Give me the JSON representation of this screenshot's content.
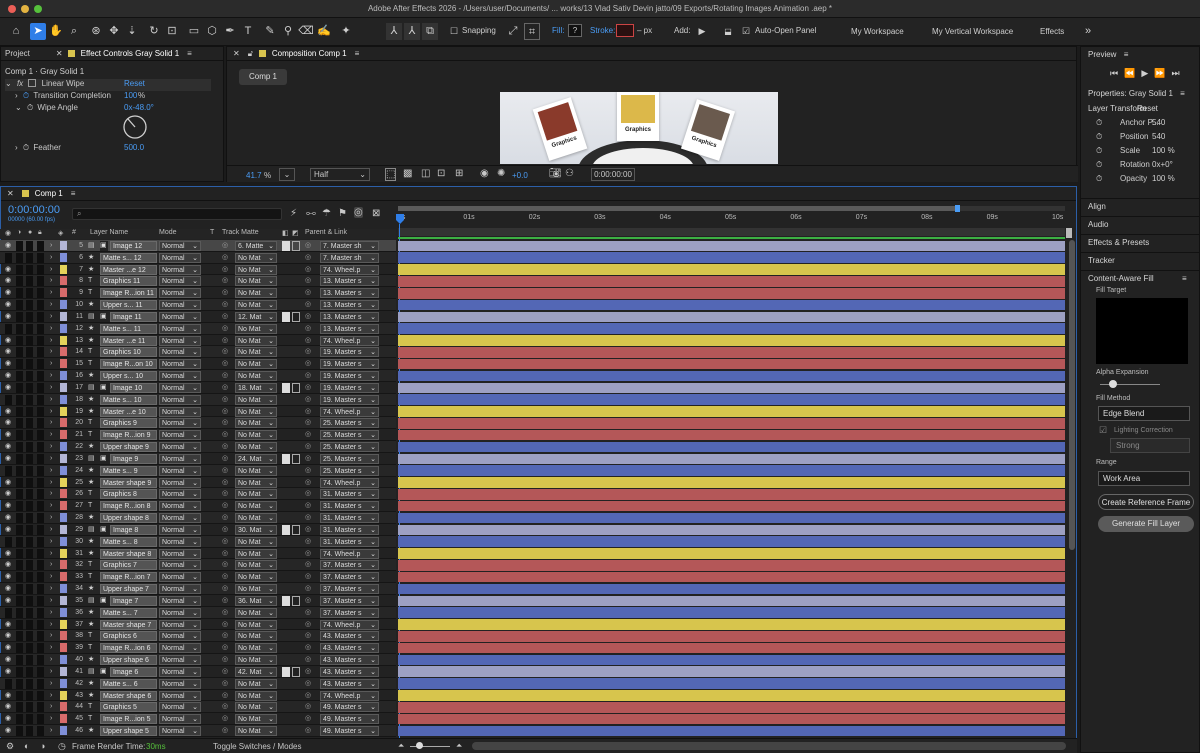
{
  "window": {
    "title": "Adobe After Effects 2026 - /Users/user/Documents/ ... works/13 Vlad Sativ Devin jatto/09 Exports/Rotating Images Animation .aep *"
  },
  "toolbar": {
    "snapping": "Snapping",
    "fill_label": "Fill:",
    "fill_value": "?",
    "stroke_label": "Stroke:",
    "stroke_px": "– px",
    "add_label": "Add:",
    "auto_open": "Auto-Open Panel",
    "workspaces": [
      "My Workspace",
      "My Vertical Workspace",
      "Effects"
    ]
  },
  "left_panel": {
    "tab_project": "Project",
    "tab_effect": "Effect Controls Gray Solid 1",
    "subtitle": "Comp 1 · Gray Solid 1",
    "fx_label": "fx",
    "effect_name": "Linear Wipe",
    "reset": "Reset",
    "props": [
      {
        "name": "Transition Completion",
        "value": "100",
        "unit": "%"
      },
      {
        "name": "Wipe Angle",
        "value": "0x-48.0°",
        "unit": ""
      },
      {
        "name": "Feather",
        "value": "500.0",
        "unit": ""
      }
    ]
  },
  "comp_panel": {
    "tab": "Composition Comp 1",
    "comp_button": "Comp 1",
    "cards": [
      "Graphics",
      "Graphics",
      "Graphics"
    ],
    "zoom": "41.7",
    "zoom_unit": "%",
    "resolution": "Half",
    "exposure": "+0.0",
    "timecode": "0:00:00:00"
  },
  "timeline": {
    "tab": "Comp 1",
    "timecode": "0:00:00:00",
    "fps": "00000 (60.00 fps)",
    "search_icon": "search-icon",
    "columns": {
      "layer_name": "Layer Name",
      "mode": "Mode",
      "t": "T",
      "track_matte": "Track Matte",
      "parent": "Parent & Link",
      "hash": "#"
    },
    "ticks": [
      "0s",
      "01s",
      "02s",
      "03s",
      "04s",
      "05s",
      "06s",
      "07s",
      "08s",
      "09s",
      "10s"
    ],
    "layers": [
      {
        "num": "5",
        "type": "img",
        "name": "Image 12",
        "mode": "Normal",
        "matte": "6. Matte",
        "par": "7. Master sh",
        "color": "lilac",
        "eye": true,
        "sel": true
      },
      {
        "num": "6",
        "type": "star",
        "name": "Matte s... 12",
        "mode": "Normal",
        "matte": "No Mat",
        "par": "7. Master sh",
        "color": "blue",
        "eye": false,
        "sel": false
      },
      {
        "num": "7",
        "type": "star",
        "name": "Master ...e 12",
        "mode": "Normal",
        "matte": "No Mat",
        "par": "74. Wheel.p",
        "color": "yellow",
        "eye": true,
        "sel": false
      },
      {
        "num": "8",
        "type": "T",
        "name": "Graphics 11",
        "mode": "Normal",
        "matte": "No Mat",
        "par": "13. Master s",
        "color": "red",
        "eye": true,
        "sel": false
      },
      {
        "num": "9",
        "type": "T",
        "name": "Image R...ion 11",
        "mode": "Normal",
        "matte": "No Mat",
        "par": "13. Master s",
        "color": "red",
        "eye": true,
        "sel": false
      },
      {
        "num": "10",
        "type": "star",
        "name": "Upper s... 11",
        "mode": "Normal",
        "matte": "No Mat",
        "par": "13. Master s",
        "color": "blue",
        "eye": true,
        "sel": false
      },
      {
        "num": "11",
        "type": "img",
        "name": "Image 11",
        "mode": "Normal",
        "matte": "12. Mat",
        "par": "13. Master s",
        "color": "lilac",
        "eye": true,
        "sel": false
      },
      {
        "num": "12",
        "type": "star",
        "name": "Matte s... 11",
        "mode": "Normal",
        "matte": "No Mat",
        "par": "13. Master s",
        "color": "blue",
        "eye": false,
        "sel": false
      },
      {
        "num": "13",
        "type": "star",
        "name": "Master ...e 11",
        "mode": "Normal",
        "matte": "No Mat",
        "par": "74. Wheel.p",
        "color": "yellow",
        "eye": true,
        "sel": false
      },
      {
        "num": "14",
        "type": "T",
        "name": "Graphics 10",
        "mode": "Normal",
        "matte": "No Mat",
        "par": "19. Master s",
        "color": "red",
        "eye": true,
        "sel": false
      },
      {
        "num": "15",
        "type": "T",
        "name": "Image R...on 10",
        "mode": "Normal",
        "matte": "No Mat",
        "par": "19. Master s",
        "color": "red",
        "eye": true,
        "sel": false
      },
      {
        "num": "16",
        "type": "star",
        "name": "Upper s... 10",
        "mode": "Normal",
        "matte": "No Mat",
        "par": "19. Master s",
        "color": "blue",
        "eye": true,
        "sel": false
      },
      {
        "num": "17",
        "type": "img",
        "name": "Image 10",
        "mode": "Normal",
        "matte": "18. Mat",
        "par": "19. Master s",
        "color": "lilac",
        "eye": true,
        "sel": false
      },
      {
        "num": "18",
        "type": "star",
        "name": "Matte s... 10",
        "mode": "Normal",
        "matte": "No Mat",
        "par": "19. Master s",
        "color": "blue",
        "eye": false,
        "sel": false
      },
      {
        "num": "19",
        "type": "star",
        "name": "Master ...e 10",
        "mode": "Normal",
        "matte": "No Mat",
        "par": "74. Wheel.p",
        "color": "yellow",
        "eye": true,
        "sel": false
      },
      {
        "num": "20",
        "type": "T",
        "name": "Graphics 9",
        "mode": "Normal",
        "matte": "No Mat",
        "par": "25. Master s",
        "color": "red",
        "eye": true,
        "sel": false
      },
      {
        "num": "21",
        "type": "T",
        "name": "Image R...ion 9",
        "mode": "Normal",
        "matte": "No Mat",
        "par": "25. Master s",
        "color": "red",
        "eye": true,
        "sel": false
      },
      {
        "num": "22",
        "type": "star",
        "name": "Upper shape 9",
        "mode": "Normal",
        "matte": "No Mat",
        "par": "25. Master s",
        "color": "blue",
        "eye": true,
        "sel": false
      },
      {
        "num": "23",
        "type": "img",
        "name": "Image 9",
        "mode": "Normal",
        "matte": "24. Mat",
        "par": "25. Master s",
        "color": "lilac",
        "eye": true,
        "sel": false
      },
      {
        "num": "24",
        "type": "star",
        "name": "Matte s... 9",
        "mode": "Normal",
        "matte": "No Mat",
        "par": "25. Master s",
        "color": "blue",
        "eye": false,
        "sel": false
      },
      {
        "num": "25",
        "type": "star",
        "name": "Master shape 9",
        "mode": "Normal",
        "matte": "No Mat",
        "par": "74. Wheel.p",
        "color": "yellow",
        "eye": true,
        "sel": false
      },
      {
        "num": "26",
        "type": "T",
        "name": "Graphics 8",
        "mode": "Normal",
        "matte": "No Mat",
        "par": "31. Master s",
        "color": "red",
        "eye": true,
        "sel": false
      },
      {
        "num": "27",
        "type": "T",
        "name": "Image R...ion 8",
        "mode": "Normal",
        "matte": "No Mat",
        "par": "31. Master s",
        "color": "red",
        "eye": true,
        "sel": false
      },
      {
        "num": "28",
        "type": "star",
        "name": "Upper shape 8",
        "mode": "Normal",
        "matte": "No Mat",
        "par": "31. Master s",
        "color": "blue",
        "eye": true,
        "sel": false
      },
      {
        "num": "29",
        "type": "img",
        "name": "Image 8",
        "mode": "Normal",
        "matte": "30. Mat",
        "par": "31. Master s",
        "color": "lilac",
        "eye": true,
        "sel": false
      },
      {
        "num": "30",
        "type": "star",
        "name": "Matte s... 8",
        "mode": "Normal",
        "matte": "No Mat",
        "par": "31. Master s",
        "color": "blue",
        "eye": false,
        "sel": false
      },
      {
        "num": "31",
        "type": "star",
        "name": "Master shape 8",
        "mode": "Normal",
        "matte": "No Mat",
        "par": "74. Wheel.p",
        "color": "yellow",
        "eye": true,
        "sel": false
      },
      {
        "num": "32",
        "type": "T",
        "name": "Graphics 7",
        "mode": "Normal",
        "matte": "No Mat",
        "par": "37. Master s",
        "color": "red",
        "eye": true,
        "sel": false
      },
      {
        "num": "33",
        "type": "T",
        "name": "Image R...ion 7",
        "mode": "Normal",
        "matte": "No Mat",
        "par": "37. Master s",
        "color": "red",
        "eye": true,
        "sel": false
      },
      {
        "num": "34",
        "type": "star",
        "name": "Upper shape 7",
        "mode": "Normal",
        "matte": "No Mat",
        "par": "37. Master s",
        "color": "blue",
        "eye": true,
        "sel": false
      },
      {
        "num": "35",
        "type": "img",
        "name": "Image 7",
        "mode": "Normal",
        "matte": "36. Mat",
        "par": "37. Master s",
        "color": "lilac",
        "eye": true,
        "sel": false
      },
      {
        "num": "36",
        "type": "star",
        "name": "Matte s... 7",
        "mode": "Normal",
        "matte": "No Mat",
        "par": "37. Master s",
        "color": "blue",
        "eye": false,
        "sel": false
      },
      {
        "num": "37",
        "type": "star",
        "name": "Master shape 7",
        "mode": "Normal",
        "matte": "No Mat",
        "par": "74. Wheel.p",
        "color": "yellow",
        "eye": true,
        "sel": false
      },
      {
        "num": "38",
        "type": "T",
        "name": "Graphics 6",
        "mode": "Normal",
        "matte": "No Mat",
        "par": "43. Master s",
        "color": "red",
        "eye": true,
        "sel": false
      },
      {
        "num": "39",
        "type": "T",
        "name": "Image R...ion 6",
        "mode": "Normal",
        "matte": "No Mat",
        "par": "43. Master s",
        "color": "red",
        "eye": true,
        "sel": false
      },
      {
        "num": "40",
        "type": "star",
        "name": "Upper shape 6",
        "mode": "Normal",
        "matte": "No Mat",
        "par": "43. Master s",
        "color": "blue",
        "eye": true,
        "sel": false
      },
      {
        "num": "41",
        "type": "img",
        "name": "Image 6",
        "mode": "Normal",
        "matte": "42. Mat",
        "par": "43. Master s",
        "color": "lilac",
        "eye": true,
        "sel": false
      },
      {
        "num": "42",
        "type": "star",
        "name": "Matte s... 6",
        "mode": "Normal",
        "matte": "No Mat",
        "par": "43. Master s",
        "color": "blue",
        "eye": false,
        "sel": false
      },
      {
        "num": "43",
        "type": "star",
        "name": "Master shape 6",
        "mode": "Normal",
        "matte": "No Mat",
        "par": "74. Wheel.p",
        "color": "yellow",
        "eye": true,
        "sel": false
      },
      {
        "num": "44",
        "type": "T",
        "name": "Graphics 5",
        "mode": "Normal",
        "matte": "No Mat",
        "par": "49. Master s",
        "color": "red",
        "eye": true,
        "sel": false
      },
      {
        "num": "45",
        "type": "T",
        "name": "Image R...ion 5",
        "mode": "Normal",
        "matte": "No Mat",
        "par": "49. Master s",
        "color": "red",
        "eye": true,
        "sel": false
      },
      {
        "num": "46",
        "type": "star",
        "name": "Upper shape 5",
        "mode": "Normal",
        "matte": "No Mat",
        "par": "49. Master s",
        "color": "blue",
        "eye": true,
        "sel": false
      }
    ],
    "footer": {
      "render_label": "Frame Render Time:",
      "render_value": "30ms",
      "toggle": "Toggle Switches / Modes"
    }
  },
  "right_panel": {
    "preview": "Preview",
    "properties_title": "Properties: Gray Solid 1",
    "layer_transform": "Layer Transform",
    "reset": "Reset",
    "transform": [
      {
        "name": "Anchor P...",
        "value": "540"
      },
      {
        "name": "Position",
        "value": "540"
      },
      {
        "name": "Scale",
        "value": "100 %"
      },
      {
        "name": "Rotation",
        "value": "0x+0°"
      },
      {
        "name": "Opacity",
        "value": "100 %"
      }
    ],
    "sections": [
      "Align",
      "Audio",
      "Effects & Presets",
      "Tracker",
      "Content-Aware Fill"
    ],
    "caf": {
      "fill_target": "Fill Target",
      "alpha_expansion": "Alpha Expansion",
      "fill_method": "Fill Method",
      "fill_method_value": "Edge Blend",
      "lighting": "Lighting Correction",
      "strength": "Strong",
      "range": "Range",
      "range_value": "Work Area",
      "create_ref": "Create Reference Frame",
      "generate": "Generate Fill Layer"
    }
  },
  "colors": {
    "accent": "#2f7ee8",
    "blue_bar": "#5367b5",
    "red_bar": "#b45758",
    "yellow_bar": "#d7c54d",
    "lilac_bar": "#9da0c3"
  }
}
